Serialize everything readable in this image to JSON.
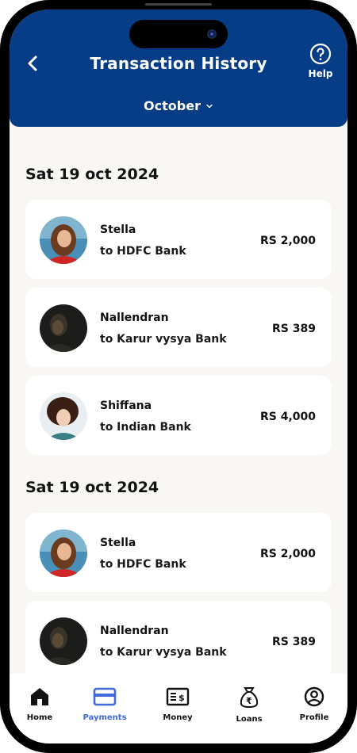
{
  "header": {
    "title": "Transaction History",
    "help_label": "Help",
    "month": "October",
    "color": "#063d86"
  },
  "groups": [
    {
      "date": "Sat 19 oct 2024",
      "transactions": [
        {
          "name": "Stella",
          "bank": "to HDFC Bank",
          "amount": "RS 2,000",
          "avatar": "avatar-stella"
        },
        {
          "name": "Nallendran",
          "bank": "to Karur vysya Bank",
          "amount": "RS 389",
          "avatar": "avatar-nallendran"
        },
        {
          "name": "Shiffana",
          "bank": "to Indian Bank",
          "amount": "RS 4,000",
          "avatar": "avatar-shiffana"
        }
      ]
    },
    {
      "date": "Sat 19 oct 2024",
      "transactions": [
        {
          "name": "Stella",
          "bank": "to HDFC Bank",
          "amount": "RS 2,000",
          "avatar": "avatar-stella"
        },
        {
          "name": "Nallendran",
          "bank": "to Karur vysya Bank",
          "amount": "RS 389",
          "avatar": "avatar-nallendran"
        }
      ]
    }
  ],
  "tabs": [
    {
      "label": "Home",
      "icon": "home-icon"
    },
    {
      "label": "Payments",
      "icon": "card-icon",
      "active": true
    },
    {
      "label": "Money",
      "icon": "money-icon"
    },
    {
      "label": "Loans",
      "icon": "rupee-bag-icon"
    },
    {
      "label": "Profile",
      "icon": "user-circle-icon"
    }
  ],
  "accent_color": "#3f6ad8"
}
